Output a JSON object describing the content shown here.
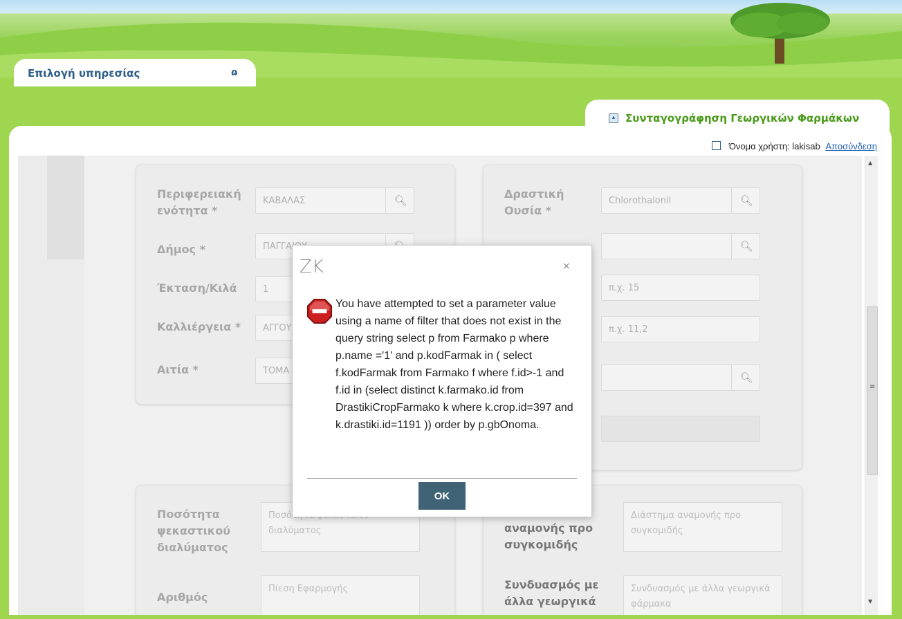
{
  "header": {
    "service_tab_label": "Επιλογή υπηρεσίας",
    "service_icon_glyph": "ɷ",
    "app_tab_title": "Συνταγογράφηση Γεωργικών Φαρμάκων",
    "user_label": "Όνομα χρήστη: lakisab",
    "logout_label": "Αποσύνδεση"
  },
  "form_left": {
    "fields": [
      {
        "label": "Περιφερειακή ενότητα *",
        "value": "ΚΑΒΑΛΑΣ"
      },
      {
        "label": "Δήμος *",
        "value": "ΠΑΓΓΑΙΟΥ"
      },
      {
        "label": "Έκταση/Κιλά",
        "value": "1"
      },
      {
        "label": "Καλλιέργεια *",
        "value": "ΑΓΓΟΥ"
      },
      {
        "label": "Αιτία *",
        "value": "ΤΟΜΑ"
      }
    ]
  },
  "form_right": {
    "fields": [
      {
        "label": "Δραστική Ουσία *",
        "value": "Chlorothalonil"
      },
      {
        "label": "",
        "value": ""
      },
      {
        "label": "",
        "placeholder": "π.χ. 15"
      },
      {
        "label": "",
        "placeholder": "π.χ. 11,2"
      },
      {
        "label": "",
        "value": ""
      }
    ]
  },
  "lower_left": {
    "fields": [
      {
        "label": "Ποσότητα ψεκαστικού διαλύματος",
        "placeholder": "Ποσότητα ψεκαστικού διαλύματος"
      },
      {
        "label": "Αριθμός",
        "placeholder": "Πίεση Εφαρμογής"
      }
    ]
  },
  "lower_right": {
    "fields": [
      {
        "label": "αναμονής προ συγκομιδής",
        "placeholder": "Διάστημα αναμονής προ συγκομιδής"
      },
      {
        "label": "Συνδυασμός με άλλα γεωργικά",
        "placeholder": "Συνδυασμός με άλλα γεωργικά φάρμακα"
      }
    ]
  },
  "modal": {
    "title": "ZK",
    "close_glyph": "×",
    "message": "You have attempted to set a parameter value using a name of filter that does not exist in the query string select p from Farmako p where p.name ='1' and p.kodFarmak in ( select f.kodFarmak from Farmako f where f.id>-1 and f.id in (select distinct k.farmako.id from DrastikiCropFarmako k where k.crop.id=397 and k.drastiki.id=1191 )) order by p.gbOnoma.",
    "ok_label": "OK"
  },
  "colors": {
    "accent_green": "#9ed64f",
    "title_blue": "#2d5e8a",
    "app_title_green": "#4a9a19",
    "ok_button": "#3f6275",
    "stop_red": "#cc1f1f"
  },
  "icons": {
    "search": "search-icon",
    "stop": "stop-sign-icon",
    "close": "close-icon",
    "external": "external-link-icon",
    "collapse": "collapse-icon",
    "service": "service-select-icon"
  }
}
